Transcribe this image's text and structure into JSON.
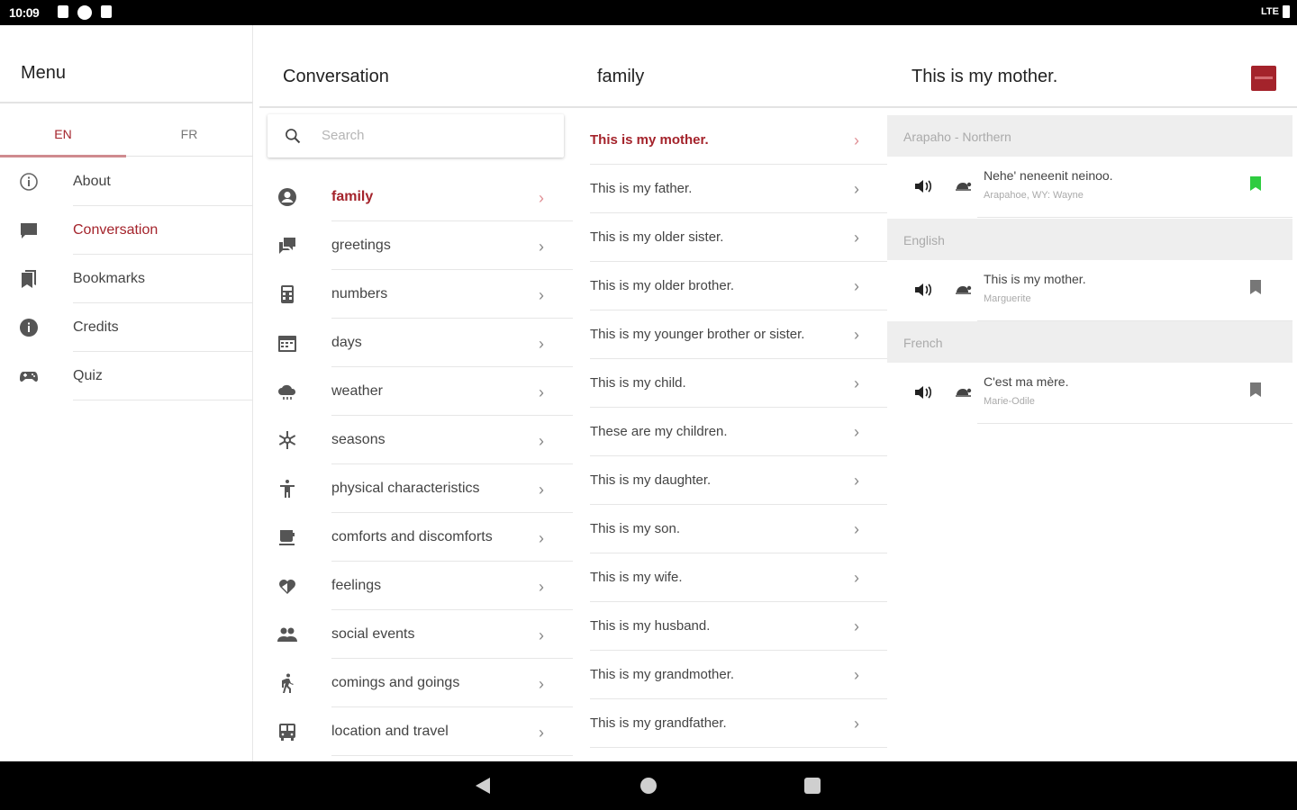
{
  "status_bar": {
    "time": "10:09",
    "network": "LTE"
  },
  "colors": {
    "accent": "#a4232b",
    "bookmark_active": "#2ecc40",
    "bookmark_inactive": "#777777"
  },
  "menu": {
    "title": "Menu",
    "lang_tabs": [
      "EN",
      "FR"
    ],
    "items": [
      {
        "label": "About",
        "icon": "info-outline-icon"
      },
      {
        "label": "Conversation",
        "icon": "chat-bubble-icon"
      },
      {
        "label": "Bookmarks",
        "icon": "bookmarks-icon"
      },
      {
        "label": "Credits",
        "icon": "info-filled-icon"
      },
      {
        "label": "Quiz",
        "icon": "gamepad-icon"
      }
    ]
  },
  "categories": {
    "title": "Conversation",
    "search_placeholder": "Search",
    "items": [
      {
        "label": "family",
        "icon": "person-icon"
      },
      {
        "label": "greetings",
        "icon": "chat-icon"
      },
      {
        "label": "numbers",
        "icon": "calculator-icon"
      },
      {
        "label": "days",
        "icon": "calendar-icon"
      },
      {
        "label": "weather",
        "icon": "cloud-icon"
      },
      {
        "label": "seasons",
        "icon": "snowflake-icon"
      },
      {
        "label": "physical characteristics",
        "icon": "accessibility-icon"
      },
      {
        "label": "comforts and discomforts",
        "icon": "coffee-icon"
      },
      {
        "label": "feelings",
        "icon": "heart-icon"
      },
      {
        "label": "social events",
        "icon": "people-icon"
      },
      {
        "label": "comings and goings",
        "icon": "walk-icon"
      },
      {
        "label": "location and travel",
        "icon": "bus-icon"
      }
    ]
  },
  "phrases": {
    "title": "family",
    "items": [
      "This is my mother.",
      "This is my father.",
      "This is my older sister.",
      "This is my older brother.",
      "This is my younger brother or sister.",
      "This is my child.",
      "These are my children.",
      "This is my daughter.",
      "This is my son.",
      "This is my wife.",
      "This is my husband.",
      "This is my grandmother.",
      "This is my grandfather."
    ]
  },
  "detail": {
    "title": "This is my mother.",
    "sections": [
      {
        "language": "Arapaho - Northern",
        "text": "Nehe' neneenit neinoo.",
        "speaker": "Arapahoe, WY: Wayne",
        "bookmarked": true
      },
      {
        "language": "English",
        "text": "This is my mother.",
        "speaker": "Marguerite",
        "bookmarked": false
      },
      {
        "language": "French",
        "text": "C'est ma mère.",
        "speaker": "Marie-Odile",
        "bookmarked": false
      }
    ]
  }
}
